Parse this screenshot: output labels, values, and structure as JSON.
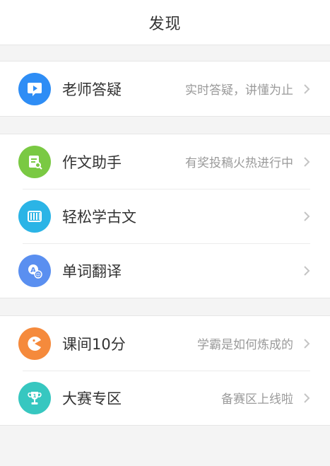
{
  "header": {
    "title": "发现"
  },
  "groups": [
    {
      "items": [
        {
          "label": "老师答疑",
          "subtitle": "实时答疑，讲懂为止",
          "icon": "video-bubble-icon",
          "color": "#2e8df5"
        }
      ]
    },
    {
      "items": [
        {
          "label": "作文助手",
          "subtitle": "有奖投稿火热进行中",
          "icon": "document-search-icon",
          "color": "#7ac943"
        },
        {
          "label": "轻松学古文",
          "subtitle": "",
          "icon": "abacus-icon",
          "color": "#2bb4e6"
        },
        {
          "label": "单词翻译",
          "subtitle": "",
          "icon": "translate-icon",
          "color": "#5a8ff0"
        }
      ]
    },
    {
      "items": [
        {
          "label": "课间10分",
          "subtitle": "学霸是如何炼成的",
          "icon": "pacman-icon",
          "color": "#f58a3c"
        },
        {
          "label": "大赛专区",
          "subtitle": "备赛区上线啦",
          "icon": "trophy-icon",
          "color": "#37c7c0"
        }
      ]
    }
  ]
}
